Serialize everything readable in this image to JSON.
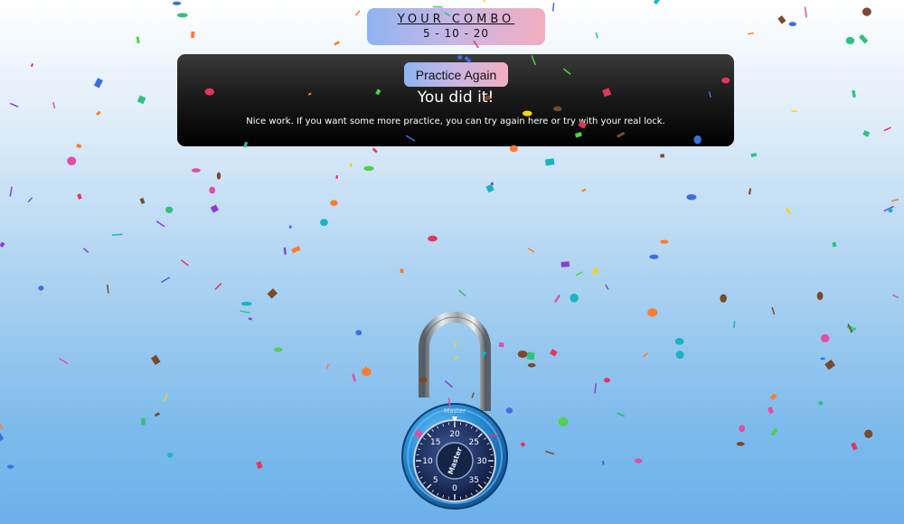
{
  "combo": {
    "title": "YOUR COMBO",
    "value": "5 - 10 - 20"
  },
  "banner": {
    "button_label": "Practice Again",
    "heading": "You did it!",
    "message": "Nice work. If you want some more practice, you can try again here or try with your real lock."
  },
  "lock": {
    "brand": "Master",
    "dial_numbers": [
      "0",
      "5",
      "10",
      "15",
      "20",
      "25",
      "30",
      "35"
    ],
    "body_color": "#2a8fd8",
    "dial_color": "#1a2a55"
  },
  "colors": {
    "accent_gradient_start": "#8fb4f1",
    "accent_gradient_end": "#f3aec0",
    "banner_background": "#111111"
  }
}
